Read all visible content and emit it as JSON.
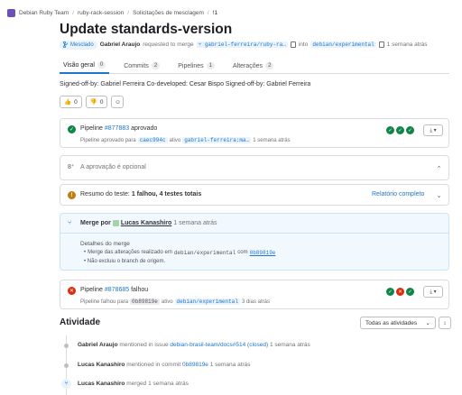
{
  "breadcrumb": [
    "Debian Ruby Team",
    "ruby-rack-session",
    "Solicitações de mesclagem",
    "!1"
  ],
  "title": "Update standards-version",
  "meta": {
    "status_badge": "Mesclado",
    "author": "Gabriel Araujo",
    "requested_text": "requested to merge",
    "source_branch": "gabriel-ferreira/ruby-ra…",
    "into_text": "into",
    "target_branch": "debian/experimental",
    "time": "1 semana atrás"
  },
  "tabs": [
    {
      "label": "Visão geral",
      "count": "0"
    },
    {
      "label": "Commits",
      "count": "2"
    },
    {
      "label": "Pipelines",
      "count": "1"
    },
    {
      "label": "Alterações",
      "count": "2"
    }
  ],
  "description": "Signed-off-by: Gabriel Ferreira Co-developed: Cesar Bispo Signed-off-by: Gabriel Ferreira",
  "reactions": {
    "thumbs_up": "0",
    "thumbs_down": "0"
  },
  "pipeline1": {
    "prefix": "Pipeline",
    "id": "#877883",
    "status": "aprovado",
    "sub_prefix": "Pipeline aprovado para",
    "commit": "caec994c",
    "ativo": "ativo",
    "branch": "gabriel-ferreira:ma…",
    "time": "1 semana atrás"
  },
  "approval": {
    "text": "A aprovação é opcional"
  },
  "tests": {
    "prefix": "Resumo do teste:",
    "failed": "1 falhou,",
    "total": "4 testes totais",
    "link": "Relatório completo"
  },
  "merge": {
    "prefix": "Merge por",
    "user": "Lucas Kanashiro",
    "time": "1 semana atrás",
    "details_title": "Detalhes do merge",
    "detail1_prefix": "Merge das alterações realizado em",
    "detail1_branch": "debian/experimental",
    "detail1_with": "com",
    "detail1_commit": "0b89819e",
    "detail2": "Não excluiu o branch de origem."
  },
  "pipeline2": {
    "prefix": "Pipeline",
    "id": "#878685",
    "status": "falhou",
    "sub_prefix": "Pipeline falhou para",
    "commit": "0b89819e",
    "ativo": "ativo",
    "branch": "debian/experimental",
    "time": "3 dias atrás"
  },
  "activity": {
    "title": "Atividade",
    "filter": "Todas as atividades",
    "items": [
      {
        "user": "Gabriel Araujo",
        "text": "mentioned in issue",
        "ref": "debian-brasil-team/docs#514 (closed)",
        "time": "1 semana atrás"
      },
      {
        "user": "Lucas Kanashiro",
        "text": "mentioned in commit",
        "ref": "0b89819e",
        "time": "1 semana atrás"
      },
      {
        "user": "Lucas Kanashiro",
        "text": "merged",
        "ref": "",
        "time": "1 semana atrás"
      }
    ]
  },
  "colors": {
    "accent": "#1f75cb",
    "success": "#108548",
    "danger": "#dd2b0e",
    "warning": "#c17d10"
  }
}
